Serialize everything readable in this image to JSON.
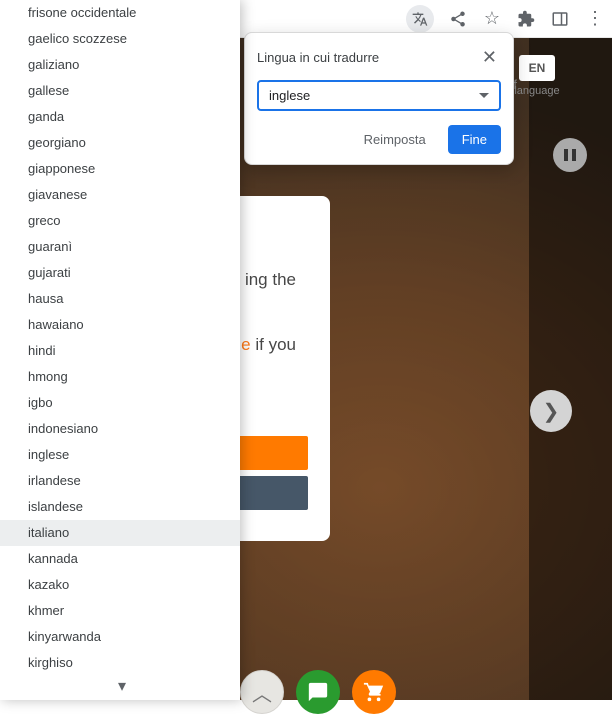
{
  "toolbar": {
    "icons": [
      "translate",
      "share",
      "star",
      "extensions",
      "panel",
      "menu"
    ]
  },
  "lang_switch": {
    "code": "EN",
    "label": "language",
    "extra": "ff"
  },
  "content_panel": {
    "line1_suffix": "ing the",
    "line2_link": "e",
    "line2_suffix": " if you"
  },
  "translate_popup": {
    "title": "Lingua in cui tradurre",
    "selected": "inglese",
    "reset": "Reimposta",
    "done": "Fine"
  },
  "languages": [
    {
      "label": "frisone occidentale",
      "hl": false
    },
    {
      "label": "gaelico scozzese",
      "hl": false
    },
    {
      "label": "galiziano",
      "hl": false
    },
    {
      "label": "gallese",
      "hl": false
    },
    {
      "label": "ganda",
      "hl": false
    },
    {
      "label": "georgiano",
      "hl": false
    },
    {
      "label": "giapponese",
      "hl": false
    },
    {
      "label": "giavanese",
      "hl": false
    },
    {
      "label": "greco",
      "hl": false
    },
    {
      "label": "guaranì",
      "hl": false
    },
    {
      "label": "gujarati",
      "hl": false
    },
    {
      "label": "hausa",
      "hl": false
    },
    {
      "label": "hawaiano",
      "hl": false
    },
    {
      "label": "hindi",
      "hl": false
    },
    {
      "label": "hmong",
      "hl": false
    },
    {
      "label": "igbo",
      "hl": false
    },
    {
      "label": "indonesiano",
      "hl": false
    },
    {
      "label": "inglese",
      "hl": false
    },
    {
      "label": "irlandese",
      "hl": false
    },
    {
      "label": "islandese",
      "hl": false
    },
    {
      "label": "italiano",
      "hl": true
    },
    {
      "label": "kannada",
      "hl": false
    },
    {
      "label": "kazako",
      "hl": false
    },
    {
      "label": "khmer",
      "hl": false
    },
    {
      "label": "kinyarwanda",
      "hl": false
    },
    {
      "label": "kirghiso",
      "hl": false
    }
  ]
}
